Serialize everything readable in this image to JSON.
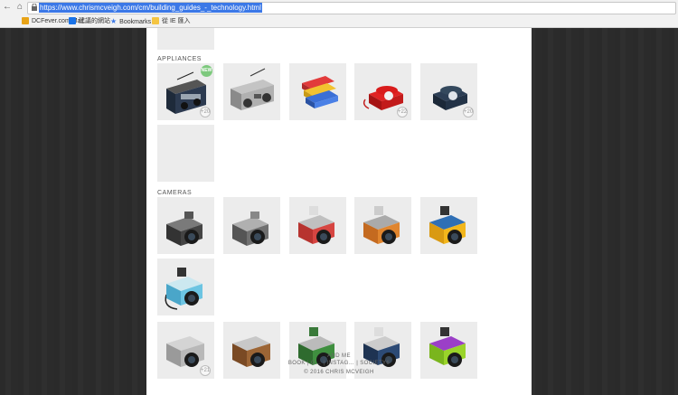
{
  "browser": {
    "url": "https://www.chrismcveigh.com/cm/building_guides_-_technology.html",
    "bookmarks": [
      {
        "label": "DCFever.com Mar…",
        "icon": "dcfever-icon",
        "color": "#e8a317"
      },
      {
        "label": "建議的網站",
        "icon": "suggested-sites-icon",
        "color": "#1a73e8"
      },
      {
        "label": "Bookmarks",
        "icon": "star-icon",
        "color": "#3b78e7"
      },
      {
        "label": "從 IE 匯入",
        "icon": "folder-icon",
        "color": "#f5c542"
      }
    ]
  },
  "sections": {
    "appliances": "APPLIANCES",
    "cameras": "CAMERAS"
  },
  "appliance_tiles": [
    {
      "name": "radio-tile",
      "badge": "+20",
      "new_label": "NEW"
    },
    {
      "name": "boombox-tile",
      "badge": ""
    },
    {
      "name": "cassettes-tile",
      "badge": ""
    },
    {
      "name": "red-phone-tile",
      "badge": "+22"
    },
    {
      "name": "navy-phone-tile",
      "badge": "+20"
    }
  ],
  "camera_tiles": [
    {
      "name": "camera-grey-1",
      "badge": ""
    },
    {
      "name": "camera-grey-2",
      "badge": ""
    },
    {
      "name": "camera-red",
      "badge": ""
    },
    {
      "name": "camera-orange",
      "badge": ""
    },
    {
      "name": "camera-yellow",
      "badge": ""
    },
    {
      "name": "camera-blue",
      "badge": ""
    }
  ],
  "bottom_tiles": [
    {
      "name": "camera-silver",
      "badge": "+21"
    },
    {
      "name": "camera-brown",
      "badge": ""
    },
    {
      "name": "camera-green",
      "badge": ""
    },
    {
      "name": "camera-navy",
      "badge": ""
    },
    {
      "name": "camera-lime",
      "badge": ""
    }
  ],
  "footer": {
    "line1": "AND ME",
    "line2": "BOOK | G… | INSTAG… | SOCIETY6",
    "line3": "© 2016 CHRIS MCVEIGH"
  },
  "colors": {
    "accent": "#3b78e7",
    "background": "#2a2a2a",
    "tile": "#ececec"
  }
}
